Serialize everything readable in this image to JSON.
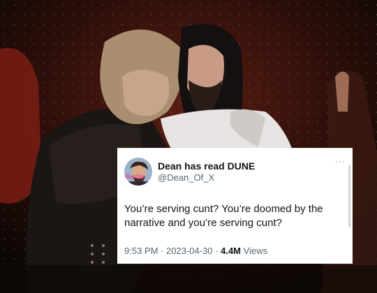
{
  "tweet": {
    "display_name": "Dean has read DUNE",
    "handle": "@Dean_Of_X",
    "avatar_badge": "Barbie",
    "more_label": "···",
    "text": "You’re serving cunt? You’re doomed by the narrative and you’re serving cunt?",
    "time": "9:53 PM",
    "date": "2023-04-30",
    "views_count": "4.4M",
    "views_label": "Views",
    "separator": "·"
  },
  "colors": {
    "stage_dark": "#120a07",
    "stage_red": "#6b1a12",
    "card_bg": "#ffffff",
    "text_primary": "#0f1419",
    "text_secondary": "#536471",
    "badge_pink": "#e8509c"
  }
}
